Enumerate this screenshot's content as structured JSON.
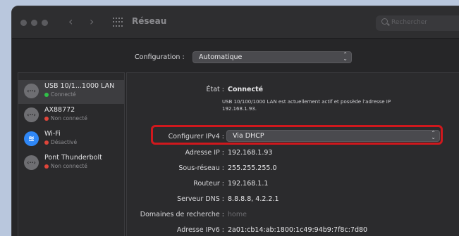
{
  "window": {
    "title": "Réseau"
  },
  "search": {
    "placeholder": "Rechercher"
  },
  "configuration": {
    "label": "Configuration :",
    "value": "Automatique"
  },
  "sidebar": {
    "items": [
      {
        "name": "USB 10/1...1000 LAN",
        "status": "Connecté",
        "status_color": "#30c048",
        "icon": "ethernet-icon",
        "icon_glyph": "‹··›",
        "selected": true
      },
      {
        "name": "AX88772",
        "status": "Non connecté",
        "status_color": "#e0453a",
        "icon": "ethernet-icon",
        "icon_glyph": "‹··›",
        "selected": false
      },
      {
        "name": "Wi-Fi",
        "status": "Désactivé",
        "status_color": "#e0453a",
        "icon": "wifi-icon",
        "icon_glyph": "≋",
        "selected": false
      },
      {
        "name": "Pont Thunderbolt",
        "status": "Non connecté",
        "status_color": "#e0453a",
        "icon": "ethernet-icon",
        "icon_glyph": "‹··›",
        "selected": false
      }
    ]
  },
  "details": {
    "etat_label": "État :",
    "etat_value": "Connecté",
    "etat_note_line1": "USB 10/100/1000 LAN est actuellement actif et possède l'adresse IP",
    "etat_note_line2": "192.168.1.93.",
    "ipv4_label": "Configurer IPv4 :",
    "ipv4_value": "Via DHCP",
    "ip_label": "Adresse IP :",
    "ip_value": "192.168.1.93",
    "subnet_label": "Sous-réseau :",
    "subnet_value": "255.255.255.0",
    "router_label": "Routeur :",
    "router_value": "192.168.1.1",
    "dns_label": "Serveur DNS :",
    "dns_value": "8.8.8.8, 4.2.2.1",
    "search_domains_label": "Domaines de recherche :",
    "search_domains_value": "home",
    "ipv6_label": "Adresse IPv6 :",
    "ipv6_value": "2a01:cb14:ab:1800:1c49:94b9:7f8c:7d80"
  },
  "colors": {
    "highlight": "#d0181d",
    "wifi_icon": "#2f87f6"
  }
}
